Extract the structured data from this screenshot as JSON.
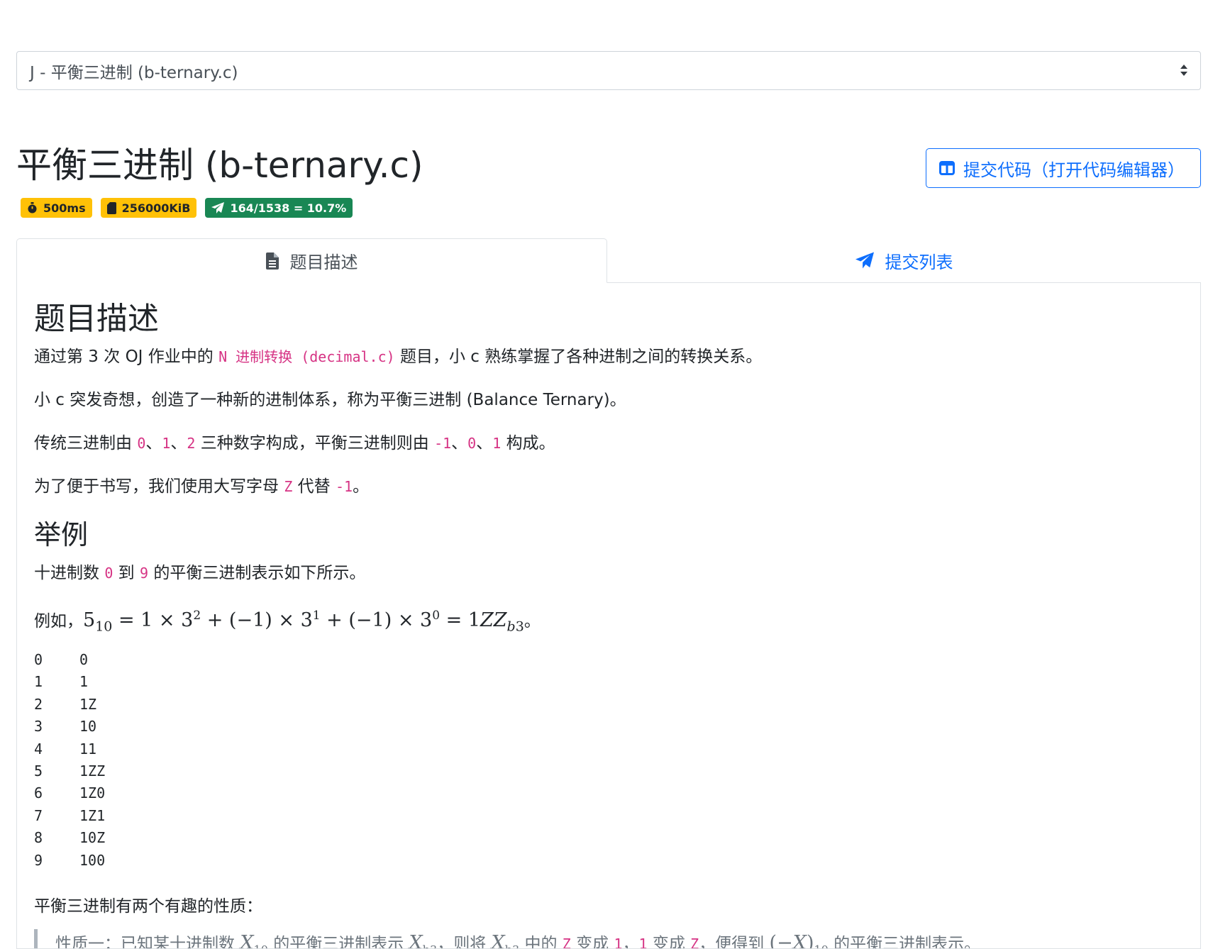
{
  "problem_select": {
    "selected": "J - 平衡三进制 (b-ternary.c)"
  },
  "problem": {
    "title": "平衡三进制 (b-ternary.c)"
  },
  "submit_button": {
    "label": "提交代码（打开代码编辑器）"
  },
  "badges": {
    "time_limit": "500ms",
    "memory_limit": "256000KiB",
    "acceptance": "164/1538 = 10.7%"
  },
  "tabs": {
    "description": "题目描述",
    "submissions": "提交列表"
  },
  "content": {
    "heading": "题目描述",
    "p1": {
      "before": "通过第 3 次 OJ 作业中的 ",
      "code": "N 进制转换 (decimal.c)",
      "after": " 题目，小 c 熟练掌握了各种进制之间的转换关系。"
    },
    "p2": "小 c 突发奇想，创造了一种新的进制体系，称为平衡三进制 (Balance Ternary)。",
    "p3": {
      "t1": "传统三进制由 ",
      "c1": "0",
      "s1": "、",
      "c2": "1",
      "s2": "、",
      "c3": "2",
      "t2": " 三种数字构成，平衡三进制则由 ",
      "c4": "-1",
      "s3": "、",
      "c5": "0",
      "s4": "、",
      "c6": "1",
      "t3": " 构成。"
    },
    "p4": {
      "t1": "为了便于书写，我们使用大写字母 ",
      "c1": "Z",
      "t2": " 代替 ",
      "c2": "-1",
      "t3": "。"
    },
    "example_heading": "举例",
    "p5": {
      "t1": "十进制数 ",
      "c1": "0",
      "t2": " 到 ",
      "c2": "9",
      "t3": " 的平衡三进制表示如下所示。"
    },
    "p6": {
      "prefix": "例如，",
      "suffix": "。"
    },
    "table": [
      [
        "0",
        "0"
      ],
      [
        "1",
        "1"
      ],
      [
        "2",
        "1Z"
      ],
      [
        "3",
        "10"
      ],
      [
        "4",
        "11"
      ],
      [
        "5",
        "1ZZ"
      ],
      [
        "6",
        "1Z0"
      ],
      [
        "7",
        "1Z1"
      ],
      [
        "8",
        "10Z"
      ],
      [
        "9",
        "100"
      ]
    ],
    "p7": "平衡三进制有两个有趣的性质：",
    "quote": {
      "t1": "性质一：已知某十进制数 ",
      "t2": " 的平衡三进制表示 ",
      "t3": "，则将 ",
      "t4": " 中的 ",
      "c1": "Z",
      "t5": " 变成 ",
      "c2": "1",
      "t6": "，",
      "c3": "1",
      "t7": " 变成 ",
      "c4": "Z",
      "t8": "，便得到 ",
      "t9": " 的平衡三进制表示。"
    }
  }
}
